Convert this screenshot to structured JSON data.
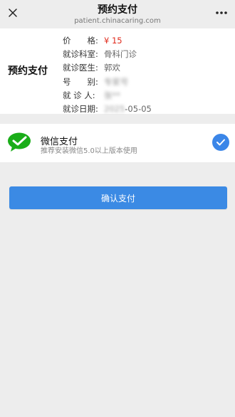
{
  "nav": {
    "title": "预约支付",
    "url": "patient.chinacaring.com"
  },
  "order": {
    "heading": "预约支付",
    "rows": [
      {
        "label": "价　　格:",
        "value": "¥ 15",
        "style": "price"
      },
      {
        "label": "就诊科室:",
        "value": "骨科门诊",
        "style": "normal"
      },
      {
        "label": "就诊医生:",
        "value": "郭欢",
        "style": "normal"
      },
      {
        "label": "号　　别:",
        "value": "专家号",
        "style": "blurred"
      },
      {
        "label": "就 诊 人:",
        "value": "张**",
        "style": "blurred"
      },
      {
        "label": "就诊日期:",
        "value": "2025-05-05",
        "style": "partial"
      }
    ]
  },
  "payment": {
    "method_title": "微信支付",
    "method_subtitle": "推荐安装微信5.0以上版本使用",
    "selected": true
  },
  "confirm_label": "确认支付",
  "colors": {
    "price": "#e0291b",
    "accent_blue": "#3b8ae4",
    "wechat_green": "#1aad19",
    "page_bg": "#ededed"
  },
  "icons": [
    "close-icon",
    "more-icon",
    "wechat-logo-icon",
    "check-icon"
  ]
}
